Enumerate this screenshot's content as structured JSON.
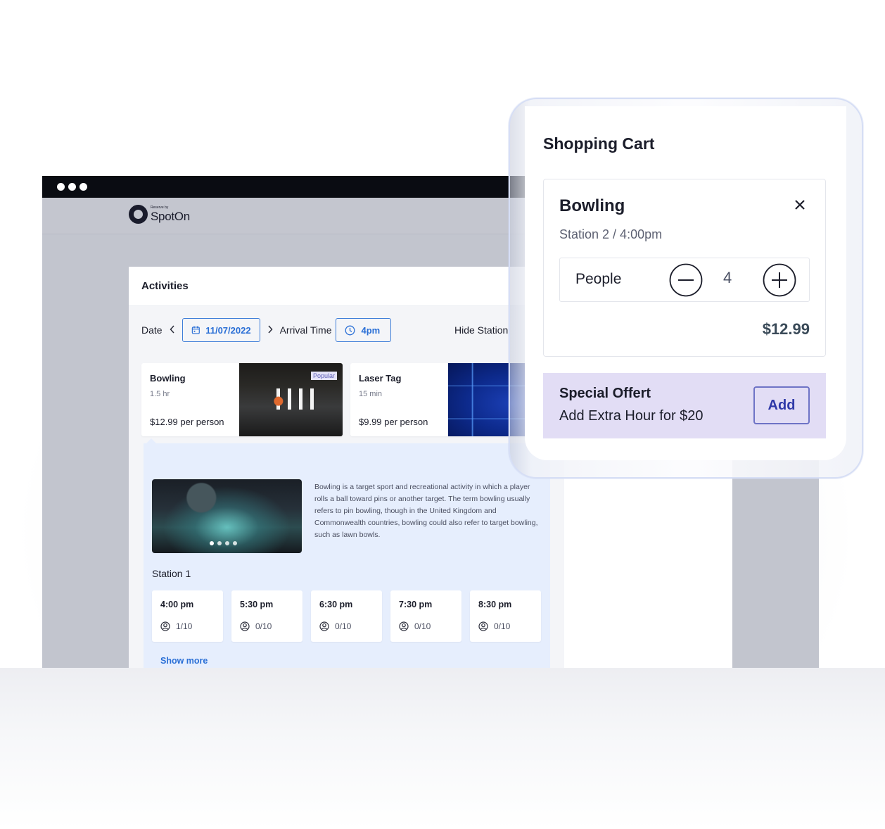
{
  "browser": {
    "window_controls": [
      "dot",
      "dot",
      "dot"
    ],
    "logo": {
      "small_text": "Reserve by",
      "brand": "SpotOn",
      "icon": "spoton-ring-icon"
    }
  },
  "activities": {
    "title": "Activities",
    "filters": {
      "date_label": "Date",
      "prev_icon": "chevron-left-icon",
      "date_value": "11/07/2022",
      "date_icon": "calendar-icon",
      "next_icon": "chevron-right-icon",
      "arrival_label": "Arrival Time",
      "time_icon": "clock-icon",
      "time_value": "4pm",
      "hide_station_label": "Hide Station"
    },
    "cards": [
      {
        "name": "Bowling",
        "duration": "1.5 hr",
        "price": "$12.99 per person",
        "badge": "Popular",
        "image": "bowling-pins-photo"
      },
      {
        "name": "Laser Tag",
        "duration": "15 min",
        "price": "$9.99 per person",
        "image": "laser-tag-photo"
      }
    ],
    "detail": {
      "image": "bowling-ball-photo",
      "carousel_dots": 4,
      "carousel_active": 1,
      "description": "Bowling is a target sport and recreational activity in which a player rolls a ball toward pins or another target. The term bowling usually refers to pin bowling, though in the United Kingdom and Commonwealth countries, bowling could also refer to target bowling, such as lawn bowls.",
      "station_label": "Station 1",
      "slots": [
        {
          "time": "4:00 pm",
          "capacity": "1/10"
        },
        {
          "time": "5:30 pm",
          "capacity": "0/10"
        },
        {
          "time": "6:30 pm",
          "capacity": "0/10"
        },
        {
          "time": "7:30 pm",
          "capacity": "0/10"
        },
        {
          "time": "8:30 pm",
          "capacity": "0/10"
        }
      ],
      "show_more": "Show more"
    }
  },
  "cart": {
    "title": "Shopping Cart",
    "item": {
      "name": "Bowling",
      "remove_icon": "close-icon",
      "subtitle": "Station 2 / 4:00pm",
      "people_label": "People",
      "quantity": "4",
      "price": "$12.99"
    },
    "offer": {
      "title": "Special Offert",
      "description": "Add Extra Hour for $20",
      "button": "Add"
    }
  },
  "colors": {
    "accent_blue": "#2a6fd6",
    "offer_bg": "#e2ddf5",
    "offer_button": "#2f39a8",
    "detail_bg": "#e6eefd",
    "page_gray": "#c2c5ce",
    "titlebar": "#0a0c12",
    "popular_badge": "#e4e2f7"
  }
}
